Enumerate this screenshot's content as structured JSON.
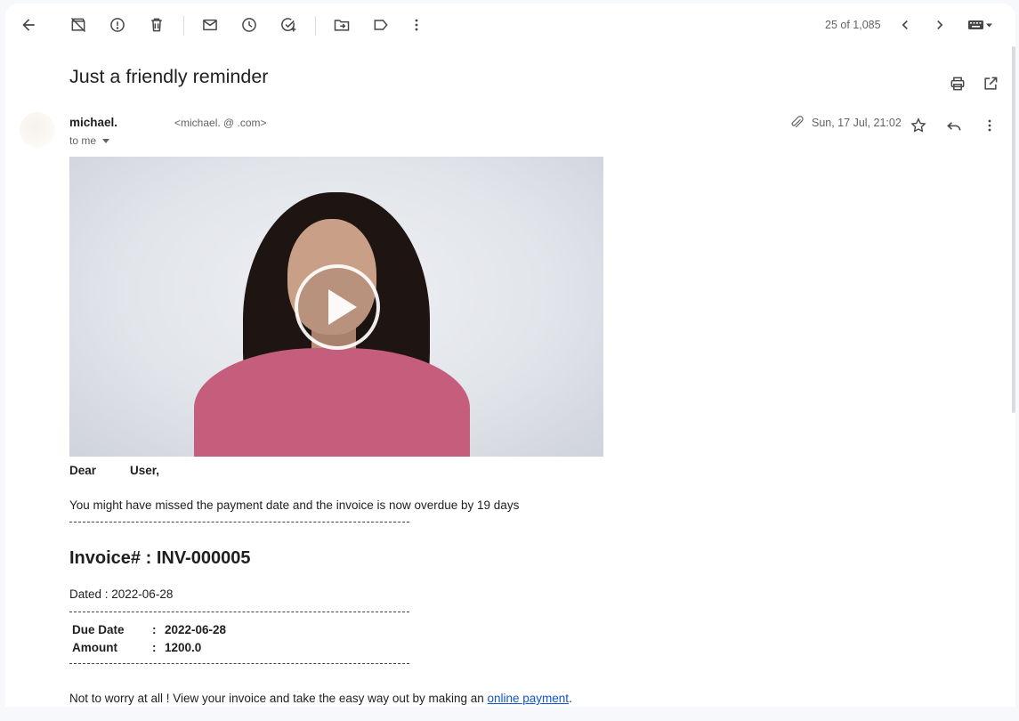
{
  "toolbar": {
    "icons": [
      "back-arrow-icon",
      "archive-icon",
      "report-spam-icon",
      "delete-icon",
      "mark-unread-icon",
      "snooze-icon",
      "add-task-icon",
      "move-to-icon",
      "label-icon",
      "more-vert-icon"
    ],
    "pager_text": "25 of 1,085"
  },
  "email": {
    "subject": "Just a friendly reminder",
    "sender_name": "michael.",
    "sender_email": "<michael.        @           .com>",
    "recipient": "to me",
    "has_attachment": true,
    "date": "Sun, 17 Jul, 21:02",
    "greeting_dear": "Dear",
    "greeting_user": "User,",
    "message": "You might have missed the payment date and the invoice is now overdue by 19 days",
    "invoice_title": "Invoice# : INV-000005",
    "dated": "Dated : 2022-06-28",
    "invoice_rows": [
      {
        "label": "Due Date",
        "sep": ":",
        "value": "2022-06-28"
      },
      {
        "label": "Amount",
        "sep": ":",
        "value": "1200.0"
      }
    ],
    "footer_pre": "Not to worry at all ! View your invoice and take the easy way out by making an ",
    "footer_link": "online payment",
    "footer_post": "."
  },
  "colors": {
    "page_bg": "#f6f8fc",
    "panel_bg": "#ffffff",
    "icon": "#444746",
    "secondary_text": "#5f6368",
    "link": "#1155cc",
    "shirt": "#c45e7c"
  }
}
